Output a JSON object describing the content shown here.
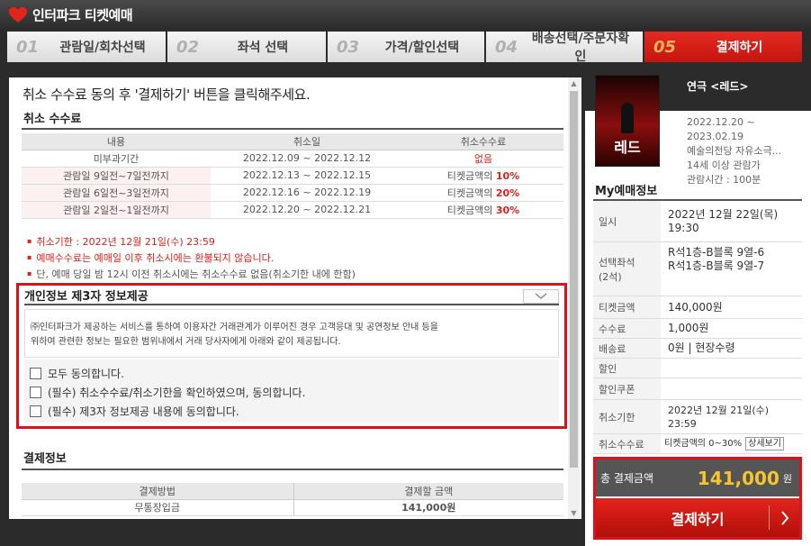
{
  "header": {
    "title": "인터파크 티켓예매"
  },
  "steps": [
    {
      "num": "01",
      "label": "관람일/회차선택"
    },
    {
      "num": "02",
      "label": "좌석 선택"
    },
    {
      "num": "03",
      "label": "가격/할인선택"
    },
    {
      "num": "04",
      "label": "배송선택/주문자확인"
    },
    {
      "num": "05",
      "label": "결제하기"
    }
  ],
  "main": {
    "instruction": "취소 수수료 동의 후 '결제하기' 버튼을 클릭해주세요.",
    "fee_section_title": "취소 수수료",
    "fee_table": {
      "headers": [
        "내용",
        "취소일",
        "취소수수료"
      ],
      "rows": [
        {
          "content": "미부과기간",
          "date": "2022.12.09 ~ 2022.12.12",
          "fee_prefix": "",
          "fee": "없음"
        },
        {
          "content": "관람일 9일전~7일전까지",
          "date": "2022.12.13 ~ 2022.12.15",
          "fee_prefix": "티켓금액의 ",
          "fee": "10%"
        },
        {
          "content": "관람일 6일전~3일전까지",
          "date": "2022.12.16 ~ 2022.12.19",
          "fee_prefix": "티켓금액의 ",
          "fee": "20%"
        },
        {
          "content": "관람일 2일전~1일전까지",
          "date": "2022.12.20 ~ 2022.12.21",
          "fee_prefix": "티켓금액의 ",
          "fee": "30%"
        }
      ]
    },
    "notes": [
      "취소기한 : 2022년 12월 21일(수) 23:59",
      "예매수수료는 예매일 이후 취소시에는 환불되지 않습니다.",
      "단, 예매 당일 밤 12시 이전 취소시에는 취소수수료 없음(취소기한 내에 한함)"
    ],
    "privacy": {
      "title": "개인정보 제3자 정보제공",
      "text_line1": "㈜인터파크가 제공하는 서비스를 통하여 이용자간 거래관계가 이루어진 경우 고객응대 및 공연정보 안내 등을",
      "text_line2": "위하여 관련한 정보는 필요한 범위내에서 거래 당사자에게 아래와 같이 제공됩니다.",
      "checks": [
        "모두 동의합니다.",
        "(필수) 취소수수료/취소기한을 확인하였으며, 동의합니다.",
        "(필수) 제3자 정보제공 내용에 동의합니다."
      ]
    },
    "payment_section_title": "결제정보",
    "payment_table": {
      "headers": [
        "결제방법",
        "결제할 금액"
      ],
      "method": "무통장입금",
      "amount": "141,000원"
    }
  },
  "sidebar": {
    "poster_text": "레드",
    "show_title": "연극 <레드>",
    "show_period_start": "2022.12.20 ~",
    "show_period_end": "2023.02.19",
    "venue": "예술의전당 자유소극...",
    "age": "14세 이상 관람가",
    "runtime": "관람시간 : 100분",
    "my_title": "My예매정보",
    "rows": {
      "date_label": "일시",
      "date_value1": "2022년 12월 22일(목)",
      "date_value2": "19:30",
      "seat_label1": "선택좌석",
      "seat_label2": "(2석)",
      "seat_value1": "R석1층-B블록 9열-6",
      "seat_value2": "R석1층-B블록 9열-7",
      "ticket_label": "티켓금액",
      "ticket_value": "140,000원",
      "fee_label": "수수료",
      "fee_value": "1,000원",
      "delivery_label": "배송료",
      "delivery_value": "0원 | 현장수령",
      "discount_label": "할인",
      "coupon_label": "할인쿠폰",
      "cancel_deadline_label": "취소기한",
      "cancel_deadline_value1": "2022년 12월 21일(수)",
      "cancel_deadline_value2": "23:59",
      "cancel_fee_label": "취소수수료",
      "cancel_fee_value": "티켓금액의 0~30%",
      "detail_button": "상세보기"
    },
    "total_label": "총 결제금액",
    "total_value": "141,000",
    "total_unit": "원",
    "pay_button": "결제하기"
  },
  "colors": {
    "accent": "#e0201a",
    "total": "#f5c531",
    "dark": "#2b2b2b"
  }
}
